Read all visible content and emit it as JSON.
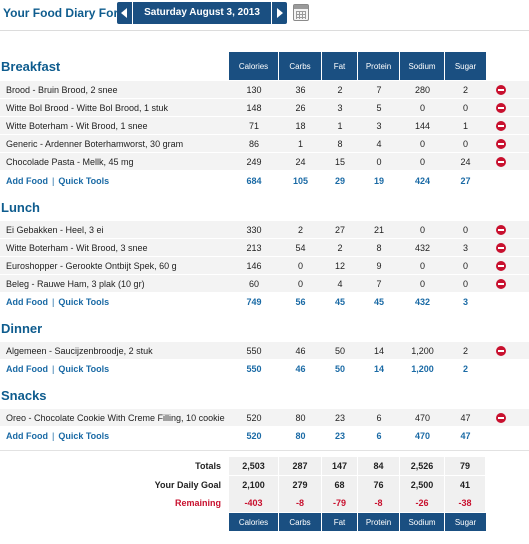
{
  "header": {
    "title": "Your Food Diary For:",
    "date": "Saturday August 3, 2013"
  },
  "columns": [
    "Calories",
    "Carbs",
    "Fat",
    "Protein",
    "Sodium",
    "Sugar"
  ],
  "links": {
    "add_food": "Add Food",
    "separator": "|",
    "quick_tools": "Quick Tools"
  },
  "meals": [
    {
      "name": "Breakfast",
      "foods": [
        {
          "name": "Brood - Bruin Brood, 2 snee",
          "values": [
            "130",
            "36",
            "2",
            "7",
            "280",
            "2"
          ]
        },
        {
          "name": "Witte Bol Brood - Witte Bol Brood, 1 stuk",
          "values": [
            "148",
            "26",
            "3",
            "5",
            "0",
            "0"
          ]
        },
        {
          "name": "Witte Boterham - Wit Brood, 1 snee",
          "values": [
            "71",
            "18",
            "1",
            "3",
            "144",
            "1"
          ]
        },
        {
          "name": "Generic - Ardenner Boterhamworst, 30 gram",
          "values": [
            "86",
            "1",
            "8",
            "4",
            "0",
            "0"
          ]
        },
        {
          "name": "Chocolade Pasta - Mellk, 45 mg",
          "values": [
            "249",
            "24",
            "15",
            "0",
            "0",
            "24"
          ]
        }
      ],
      "totals": [
        "684",
        "105",
        "29",
        "19",
        "424",
        "27"
      ]
    },
    {
      "name": "Lunch",
      "foods": [
        {
          "name": "Ei Gebakken - Heel, 3 ei",
          "values": [
            "330",
            "2",
            "27",
            "21",
            "0",
            "0"
          ]
        },
        {
          "name": "Witte Boterham - Wit Brood, 3 snee",
          "values": [
            "213",
            "54",
            "2",
            "8",
            "432",
            "3"
          ]
        },
        {
          "name": "Euroshopper - Gerookte Ontbijt Spek, 60 g",
          "values": [
            "146",
            "0",
            "12",
            "9",
            "0",
            "0"
          ]
        },
        {
          "name": "Beleg - Rauwe Ham, 3 plak (10 gr)",
          "values": [
            "60",
            "0",
            "4",
            "7",
            "0",
            "0"
          ]
        }
      ],
      "totals": [
        "749",
        "56",
        "45",
        "45",
        "432",
        "3"
      ]
    },
    {
      "name": "Dinner",
      "foods": [
        {
          "name": "Algemeen - Saucijzenbroodje, 2 stuk",
          "values": [
            "550",
            "46",
            "50",
            "14",
            "1,200",
            "2"
          ]
        }
      ],
      "totals": [
        "550",
        "46",
        "50",
        "14",
        "1,200",
        "2"
      ]
    },
    {
      "name": "Snacks",
      "foods": [
        {
          "name": "Oreo - Chocolate Cookie With Creme Filling, 10 cookie",
          "values": [
            "520",
            "80",
            "23",
            "6",
            "470",
            "47"
          ]
        }
      ],
      "totals": [
        "520",
        "80",
        "23",
        "6",
        "470",
        "47"
      ]
    }
  ],
  "summary": [
    {
      "label": "Totals",
      "values": [
        "2,503",
        "287",
        "147",
        "84",
        "2,526",
        "79"
      ]
    },
    {
      "label": "Your Daily Goal",
      "values": [
        "2,100",
        "279",
        "68",
        "76",
        "2,500",
        "41"
      ]
    },
    {
      "label": "Remaining",
      "values": [
        "-403",
        "-8",
        "-79",
        "-8",
        "-26",
        "-38"
      ]
    }
  ],
  "colors": {
    "header_bg": "#1a4f81",
    "section_title": "#0e5c8e",
    "link": "#1a6aa5",
    "remaining": "#c8102e",
    "remove_icon": "#c8102e"
  }
}
